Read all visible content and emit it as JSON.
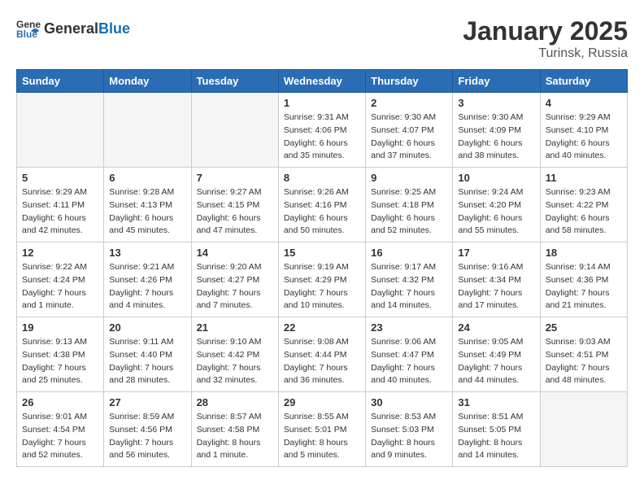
{
  "logo": {
    "general": "General",
    "blue": "Blue"
  },
  "title": "January 2025",
  "location": "Turinsk, Russia",
  "days_of_week": [
    "Sunday",
    "Monday",
    "Tuesday",
    "Wednesday",
    "Thursday",
    "Friday",
    "Saturday"
  ],
  "weeks": [
    [
      {
        "num": "",
        "sunrise": "",
        "sunset": "",
        "daylight": "",
        "empty": true
      },
      {
        "num": "",
        "sunrise": "",
        "sunset": "",
        "daylight": "",
        "empty": true
      },
      {
        "num": "",
        "sunrise": "",
        "sunset": "",
        "daylight": "",
        "empty": true
      },
      {
        "num": "1",
        "sunrise": "Sunrise: 9:31 AM",
        "sunset": "Sunset: 4:06 PM",
        "daylight": "Daylight: 6 hours and 35 minutes."
      },
      {
        "num": "2",
        "sunrise": "Sunrise: 9:30 AM",
        "sunset": "Sunset: 4:07 PM",
        "daylight": "Daylight: 6 hours and 37 minutes."
      },
      {
        "num": "3",
        "sunrise": "Sunrise: 9:30 AM",
        "sunset": "Sunset: 4:09 PM",
        "daylight": "Daylight: 6 hours and 38 minutes."
      },
      {
        "num": "4",
        "sunrise": "Sunrise: 9:29 AM",
        "sunset": "Sunset: 4:10 PM",
        "daylight": "Daylight: 6 hours and 40 minutes."
      }
    ],
    [
      {
        "num": "5",
        "sunrise": "Sunrise: 9:29 AM",
        "sunset": "Sunset: 4:11 PM",
        "daylight": "Daylight: 6 hours and 42 minutes."
      },
      {
        "num": "6",
        "sunrise": "Sunrise: 9:28 AM",
        "sunset": "Sunset: 4:13 PM",
        "daylight": "Daylight: 6 hours and 45 minutes."
      },
      {
        "num": "7",
        "sunrise": "Sunrise: 9:27 AM",
        "sunset": "Sunset: 4:15 PM",
        "daylight": "Daylight: 6 hours and 47 minutes."
      },
      {
        "num": "8",
        "sunrise": "Sunrise: 9:26 AM",
        "sunset": "Sunset: 4:16 PM",
        "daylight": "Daylight: 6 hours and 50 minutes."
      },
      {
        "num": "9",
        "sunrise": "Sunrise: 9:25 AM",
        "sunset": "Sunset: 4:18 PM",
        "daylight": "Daylight: 6 hours and 52 minutes."
      },
      {
        "num": "10",
        "sunrise": "Sunrise: 9:24 AM",
        "sunset": "Sunset: 4:20 PM",
        "daylight": "Daylight: 6 hours and 55 minutes."
      },
      {
        "num": "11",
        "sunrise": "Sunrise: 9:23 AM",
        "sunset": "Sunset: 4:22 PM",
        "daylight": "Daylight: 6 hours and 58 minutes."
      }
    ],
    [
      {
        "num": "12",
        "sunrise": "Sunrise: 9:22 AM",
        "sunset": "Sunset: 4:24 PM",
        "daylight": "Daylight: 7 hours and 1 minute."
      },
      {
        "num": "13",
        "sunrise": "Sunrise: 9:21 AM",
        "sunset": "Sunset: 4:26 PM",
        "daylight": "Daylight: 7 hours and 4 minutes."
      },
      {
        "num": "14",
        "sunrise": "Sunrise: 9:20 AM",
        "sunset": "Sunset: 4:27 PM",
        "daylight": "Daylight: 7 hours and 7 minutes."
      },
      {
        "num": "15",
        "sunrise": "Sunrise: 9:19 AM",
        "sunset": "Sunset: 4:29 PM",
        "daylight": "Daylight: 7 hours and 10 minutes."
      },
      {
        "num": "16",
        "sunrise": "Sunrise: 9:17 AM",
        "sunset": "Sunset: 4:32 PM",
        "daylight": "Daylight: 7 hours and 14 minutes."
      },
      {
        "num": "17",
        "sunrise": "Sunrise: 9:16 AM",
        "sunset": "Sunset: 4:34 PM",
        "daylight": "Daylight: 7 hours and 17 minutes."
      },
      {
        "num": "18",
        "sunrise": "Sunrise: 9:14 AM",
        "sunset": "Sunset: 4:36 PM",
        "daylight": "Daylight: 7 hours and 21 minutes."
      }
    ],
    [
      {
        "num": "19",
        "sunrise": "Sunrise: 9:13 AM",
        "sunset": "Sunset: 4:38 PM",
        "daylight": "Daylight: 7 hours and 25 minutes."
      },
      {
        "num": "20",
        "sunrise": "Sunrise: 9:11 AM",
        "sunset": "Sunset: 4:40 PM",
        "daylight": "Daylight: 7 hours and 28 minutes."
      },
      {
        "num": "21",
        "sunrise": "Sunrise: 9:10 AM",
        "sunset": "Sunset: 4:42 PM",
        "daylight": "Daylight: 7 hours and 32 minutes."
      },
      {
        "num": "22",
        "sunrise": "Sunrise: 9:08 AM",
        "sunset": "Sunset: 4:44 PM",
        "daylight": "Daylight: 7 hours and 36 minutes."
      },
      {
        "num": "23",
        "sunrise": "Sunrise: 9:06 AM",
        "sunset": "Sunset: 4:47 PM",
        "daylight": "Daylight: 7 hours and 40 minutes."
      },
      {
        "num": "24",
        "sunrise": "Sunrise: 9:05 AM",
        "sunset": "Sunset: 4:49 PM",
        "daylight": "Daylight: 7 hours and 44 minutes."
      },
      {
        "num": "25",
        "sunrise": "Sunrise: 9:03 AM",
        "sunset": "Sunset: 4:51 PM",
        "daylight": "Daylight: 7 hours and 48 minutes."
      }
    ],
    [
      {
        "num": "26",
        "sunrise": "Sunrise: 9:01 AM",
        "sunset": "Sunset: 4:54 PM",
        "daylight": "Daylight: 7 hours and 52 minutes."
      },
      {
        "num": "27",
        "sunrise": "Sunrise: 8:59 AM",
        "sunset": "Sunset: 4:56 PM",
        "daylight": "Daylight: 7 hours and 56 minutes."
      },
      {
        "num": "28",
        "sunrise": "Sunrise: 8:57 AM",
        "sunset": "Sunset: 4:58 PM",
        "daylight": "Daylight: 8 hours and 1 minute."
      },
      {
        "num": "29",
        "sunrise": "Sunrise: 8:55 AM",
        "sunset": "Sunset: 5:01 PM",
        "daylight": "Daylight: 8 hours and 5 minutes."
      },
      {
        "num": "30",
        "sunrise": "Sunrise: 8:53 AM",
        "sunset": "Sunset: 5:03 PM",
        "daylight": "Daylight: 8 hours and 9 minutes."
      },
      {
        "num": "31",
        "sunrise": "Sunrise: 8:51 AM",
        "sunset": "Sunset: 5:05 PM",
        "daylight": "Daylight: 8 hours and 14 minutes."
      },
      {
        "num": "",
        "sunrise": "",
        "sunset": "",
        "daylight": "",
        "empty": true
      }
    ]
  ]
}
